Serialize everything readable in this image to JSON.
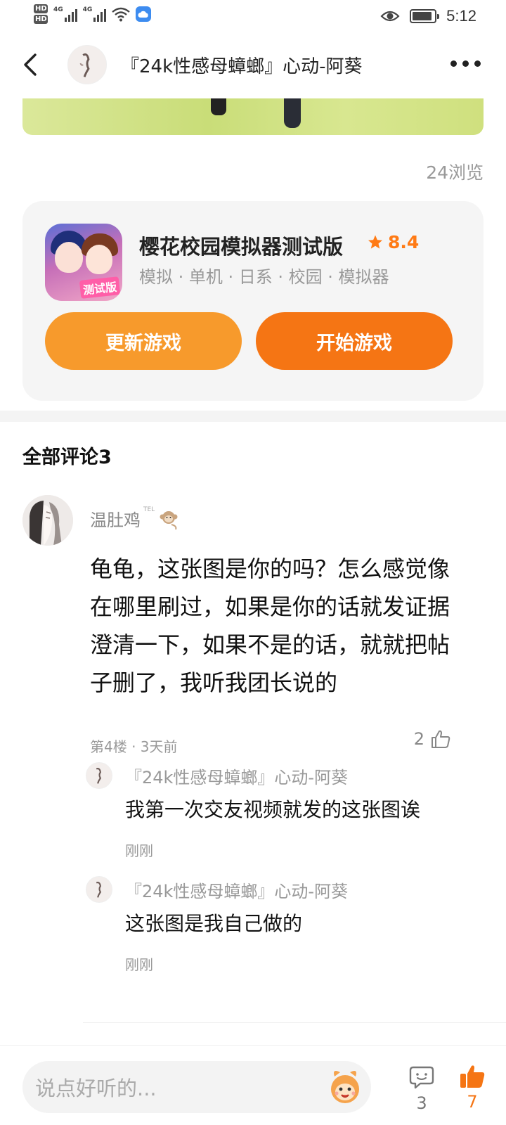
{
  "status_bar": {
    "hd_top": "HD",
    "hd_bottom": "HD",
    "network_1": "4G",
    "network_2": "4G",
    "time": "5:12"
  },
  "header": {
    "title": "『24k性感母蟑螂』心动-阿葵"
  },
  "post": {
    "views": "24浏览"
  },
  "game": {
    "name": "樱花校园模拟器测试版",
    "rating": "8.4",
    "tags": "模拟 · 单机 · 日系 · 校园 · 模拟器",
    "badge": "测试版",
    "update_label": "更新游戏",
    "start_label": "开始游戏",
    "accent_color": "#f57514"
  },
  "comments": {
    "title": "全部评论3",
    "main": {
      "author": "温肚鸡",
      "badge": "TEL",
      "body": "龟龟，这张图是你的吗？怎么感觉像在哪里刷过，如果是你的话就发证据澄清一下，如果不是的话，就就把帖子删了，我听我团长说的",
      "meta": "第4楼 · 3天前",
      "likes": "2"
    },
    "replies": [
      {
        "author": "『24k性感母蟑螂』心动-阿葵",
        "body": "我第一次交友视频就发的这张图诶",
        "time": "刚刚"
      },
      {
        "author": "『24k性感母蟑螂』心动-阿葵",
        "body": "这张图是我自己做的",
        "time": "刚刚"
      }
    ]
  },
  "bottom_bar": {
    "input_placeholder": "说点好听的...",
    "comment_count": "3",
    "like_count": "7"
  },
  "icons": {
    "back": "back-icon",
    "more": "more-icon",
    "star": "star-icon",
    "like": "thumb-up-icon",
    "comment": "comment-bubble-icon",
    "mascot": "mascot-icon"
  }
}
